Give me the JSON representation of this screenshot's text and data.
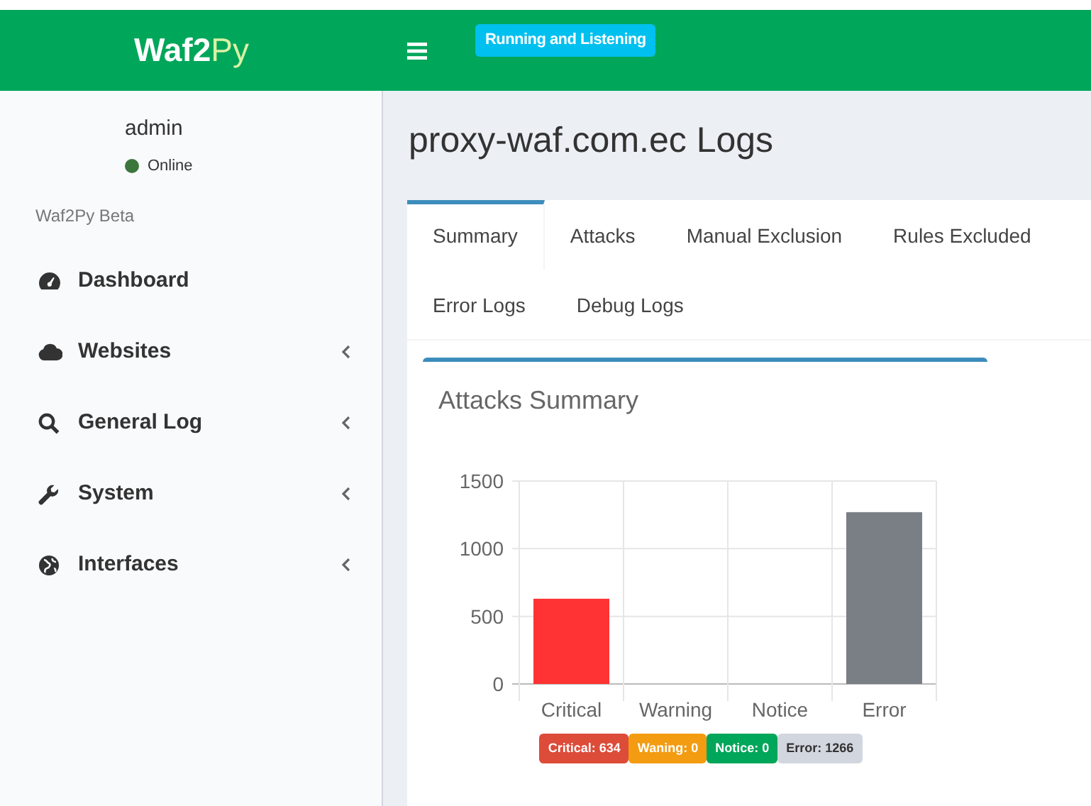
{
  "header": {
    "logo_bold": "Waf2",
    "logo_light": "Py",
    "status_badge": "Running and Listening"
  },
  "sidebar": {
    "user": {
      "name": "admin",
      "status": "Online",
      "color": "#3c763d"
    },
    "section_label": "Waf2Py Beta",
    "items": [
      {
        "label": "Dashboard",
        "kind": "gauge",
        "submenu": false
      },
      {
        "label": "Websites",
        "kind": "cloud",
        "submenu": true
      },
      {
        "label": "General Log",
        "kind": "search",
        "submenu": true
      },
      {
        "label": "System",
        "kind": "wrench",
        "submenu": true
      },
      {
        "label": "Interfaces",
        "kind": "globe",
        "submenu": true
      }
    ]
  },
  "page_title": "proxy-waf.com.ec Logs",
  "tabs": [
    {
      "label": "Summary",
      "selected": true
    },
    {
      "label": "Attacks",
      "selected": false
    },
    {
      "label": "Manual Exclusion",
      "selected": false
    },
    {
      "label": "Rules Excluded",
      "selected": false
    },
    {
      "label": "Error Logs",
      "selected": false
    },
    {
      "label": "Debug Logs",
      "selected": false
    }
  ],
  "summary": {
    "title": "Attacks Summary",
    "chart_data": {
      "type": "bar",
      "categories": [
        "Critical",
        "Warning",
        "Notice",
        "Error"
      ],
      "series": [
        {
          "color": "#ff3333",
          "values": [
            630,
            null,
            null,
            null
          ]
        },
        {
          "color": "#7a7f86",
          "values": [
            null,
            null,
            null,
            1270
          ]
        }
      ],
      "ylim": [
        0,
        1500
      ],
      "yticks": [
        0,
        500,
        1000,
        1500
      ]
    },
    "badges": [
      {
        "text": "Critical: 634",
        "color": "#dd4b39"
      },
      {
        "text": "Waning: 0",
        "color": "#f39c12"
      },
      {
        "text": "Notice: 0",
        "color": "#00a65a"
      },
      {
        "text": "Error: 1266",
        "color": "#d2d6de"
      }
    ]
  }
}
